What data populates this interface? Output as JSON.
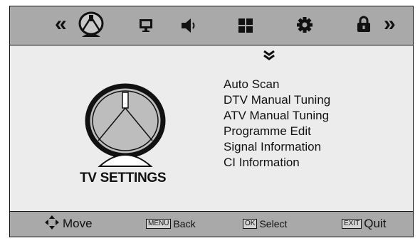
{
  "header": {
    "prev_arrow": "«",
    "next_arrow": "»",
    "icons": [
      "satellite-dish-icon",
      "picture-icon",
      "sound-icon",
      "apps-icon",
      "gear-icon",
      "lock-icon"
    ],
    "active_icon": "satellite-dish-icon"
  },
  "category": {
    "title": "TV SETTINGS",
    "icon": "satellite-dish-icon"
  },
  "menu": {
    "items": [
      "Auto Scan",
      "DTV Manual Tuning",
      "ATV Manual Tuning",
      "Programme Edit",
      "Signal Information",
      "CI Information"
    ]
  },
  "footer": {
    "move": "Move",
    "menu_key": "MENU",
    "back": "Back",
    "ok_key": "OK",
    "select": "Select",
    "exit_key": "EXIT",
    "quit": "Quit"
  },
  "colors": {
    "bar": "#a9a9a9",
    "panel": "#ececec",
    "active_icon_fill": "#c9c9c9"
  }
}
